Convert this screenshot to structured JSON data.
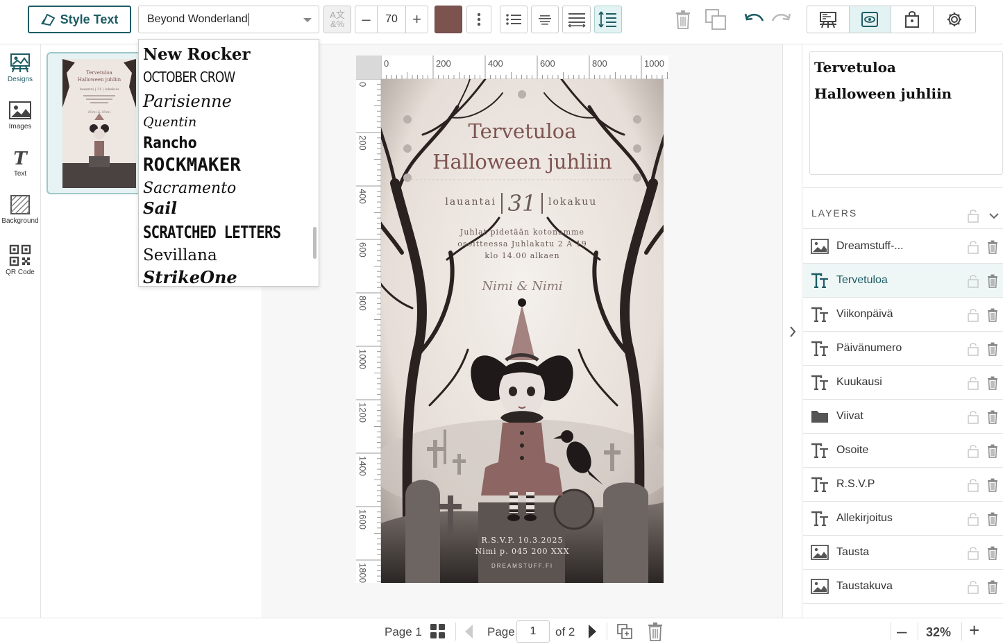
{
  "toolbar": {
    "style_text_label": "Style Text",
    "font_value": "Beyond Wonderland",
    "font_size": "70",
    "text_color": "#7d5350",
    "accent": "#1d5c63"
  },
  "left_nav": [
    {
      "label": "Designs",
      "icon": "designs-icon"
    },
    {
      "label": "Images",
      "icon": "images-icon"
    },
    {
      "label": "Text",
      "icon": "text-icon"
    },
    {
      "label": "Background",
      "icon": "background-icon"
    },
    {
      "label": "QR Code",
      "icon": "qr-code-icon"
    }
  ],
  "font_options": [
    "New Rocker",
    "OCTOBER CROW",
    "Parisienne",
    "Quentin",
    "Rancho",
    "ROCKMAKER",
    "Sacramento",
    "Sail",
    "SCRATCHED LETTERS",
    "Sevillana",
    "StrikeOne"
  ],
  "ruler": {
    "top_labels": [
      "0",
      "200",
      "400",
      "600",
      "800",
      "1000"
    ],
    "left_labels": [
      "0",
      "200",
      "400",
      "600",
      "800",
      "1000",
      "1200",
      "1400",
      "1600",
      "1800"
    ]
  },
  "design": {
    "title_line1": "Tervetuloa",
    "title_line2": "Halloween juhliin",
    "weekday": "lauantai",
    "day_number": "31",
    "month": "lokakuu",
    "address_line1": "Juhlat pidetään kotonamme",
    "address_line2": "osoitteessa Juhlakatu 2 A 19",
    "address_line3": "klo 14.00 alkaen",
    "signature": "Nimi & Nimi",
    "rsvp_line1": "R.S.V.P. 10.3.2025",
    "rsvp_line2": "Nimi p. 045 200 XXX",
    "brand": "DREAMSTUFF.FI"
  },
  "preview": {
    "line1": "Tervetuloa",
    "line2": "Halloween juhliin"
  },
  "layers": {
    "title": "LAYERS",
    "items": [
      {
        "name": "Dreamstuff-...",
        "type": "image"
      },
      {
        "name": "Tervetuloa",
        "type": "text",
        "selected": true
      },
      {
        "name": "Viikonpäivä",
        "type": "text"
      },
      {
        "name": "Päivänumero",
        "type": "text"
      },
      {
        "name": "Kuukausi",
        "type": "text"
      },
      {
        "name": "Viivat",
        "type": "folder"
      },
      {
        "name": "Osoite",
        "type": "text"
      },
      {
        "name": "R.S.V.P",
        "type": "text"
      },
      {
        "name": "Allekirjoitus",
        "type": "text"
      },
      {
        "name": "Tausta",
        "type": "image"
      },
      {
        "name": "Taustakuva",
        "type": "image"
      }
    ]
  },
  "bottom": {
    "page_label": "Page 1",
    "page_word": "Page",
    "page_number": "1",
    "of_total": "of 2",
    "zoom": "32%"
  }
}
